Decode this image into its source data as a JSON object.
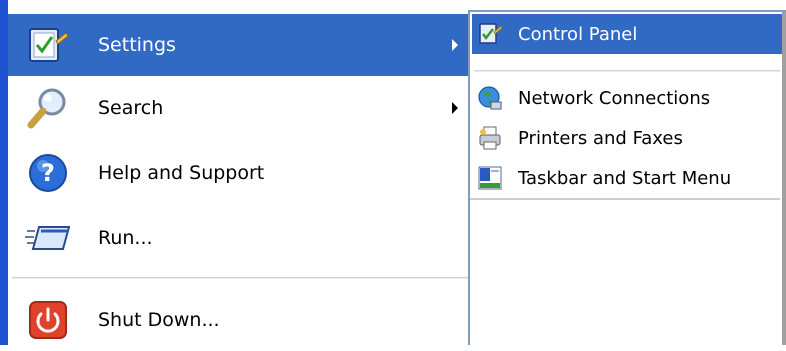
{
  "start_menu": {
    "items": [
      {
        "label": "Settings",
        "icon": "settings-checklist-icon",
        "has_submenu": true,
        "highlighted": true
      },
      {
        "label": "Search",
        "icon": "magnifier-icon",
        "has_submenu": true,
        "highlighted": false
      },
      {
        "label": "Help and Support",
        "icon": "help-question-icon",
        "has_submenu": false,
        "highlighted": false
      },
      {
        "label": "Run...",
        "icon": "run-window-icon",
        "has_submenu": false,
        "highlighted": false
      },
      {
        "label": "Shut Down...",
        "icon": "power-icon",
        "has_submenu": false,
        "highlighted": false
      }
    ]
  },
  "submenu": {
    "items": [
      {
        "label": "Control Panel",
        "icon": "control-panel-icon",
        "highlighted": true
      },
      {
        "label": "Network Connections",
        "icon": "network-globe-icon",
        "highlighted": false
      },
      {
        "label": "Printers and Faxes",
        "icon": "printer-icon",
        "highlighted": false
      },
      {
        "label": "Taskbar and Start Menu",
        "icon": "taskbar-icon",
        "highlighted": false
      }
    ]
  },
  "colors": {
    "highlight": "#316ac5",
    "left_edge": "#1e50d2",
    "power_red": "#e0412a",
    "help_blue": "#2a6fd9"
  }
}
